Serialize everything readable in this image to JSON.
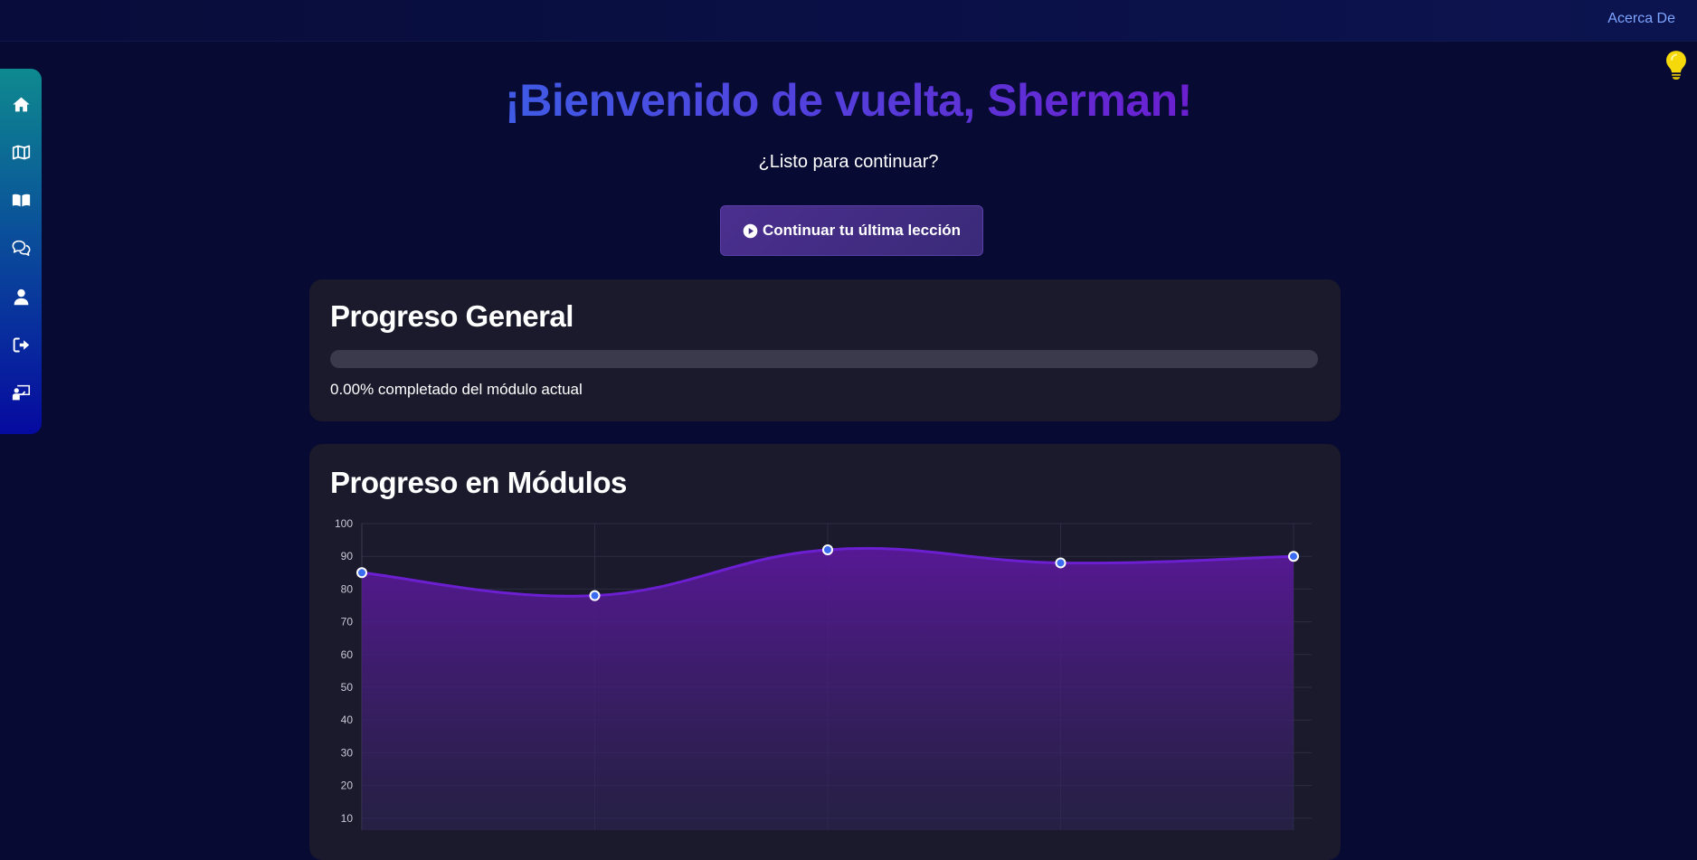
{
  "header": {
    "about_label": "Acerca De"
  },
  "sidebar": {
    "items": [
      {
        "icon": "home-icon"
      },
      {
        "icon": "map-icon"
      },
      {
        "icon": "book-icon"
      },
      {
        "icon": "comments-icon"
      },
      {
        "icon": "user-icon"
      },
      {
        "icon": "logout-icon"
      },
      {
        "icon": "teacher-icon"
      }
    ]
  },
  "hint_icon": "lightbulb-icon",
  "welcome": {
    "title": "¡Bienvenido de vuelta, Sherman!",
    "subtitle": "¿Listo para continuar?",
    "continue_label": "Continuar tu última lección"
  },
  "progress_general": {
    "title": "Progreso General",
    "percent": 0,
    "text": "0.00% completado del módulo actual"
  },
  "modules_progress": {
    "title": "Progreso en Módulos"
  },
  "colors": {
    "accent": "#6b1fd0",
    "title_gradient_start": "#3f5be6",
    "title_gradient_end": "#6b1fd0",
    "link": "#7fa6ff",
    "point": "#3a6bf0"
  },
  "chart_data": {
    "type": "area",
    "x": [
      1,
      2,
      3,
      4,
      5
    ],
    "values": [
      85,
      78,
      92,
      88,
      90
    ],
    "y_ticks": [
      10,
      20,
      30,
      40,
      50,
      60,
      70,
      80,
      90,
      100
    ],
    "ylim": [
      0,
      100
    ],
    "grid": true
  }
}
